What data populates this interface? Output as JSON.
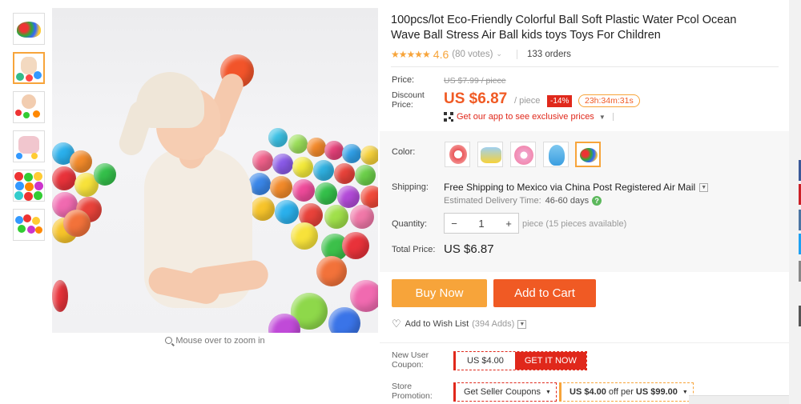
{
  "product": {
    "title": "100pcs/lot Eco-Friendly Colorful Ball Soft Plastic Water Pcol Ocean Wave Ball Stress Air Ball kids toys Toys For Children",
    "rating": "4.6",
    "stars": "★★★★★",
    "votes": "(80 votes)",
    "orders": "133 orders"
  },
  "gallery": {
    "zoom_hint": "Mouse over to zoom in"
  },
  "price": {
    "price_label": "Price:",
    "original": "US $7.99 / piece",
    "discount_label": "Discount Price:",
    "discount_value": "US $6.87",
    "unit": "/ piece",
    "percent_off": "-14%",
    "countdown": "23h:34m:31s",
    "app_promo": "Get our app to see exclusive prices"
  },
  "options": {
    "color_label": "Color:",
    "shipping_label": "Shipping:",
    "shipping_value": "Free Shipping to Mexico via China Post Registered Air Mail",
    "delivery_label": "Estimated Delivery Time:",
    "delivery_value": "46-60 days",
    "quantity_label": "Quantity:",
    "quantity_value": "1",
    "qty_minus": "−",
    "qty_plus": "+",
    "qty_available": "piece (15 pieces available)",
    "total_label": "Total Price:",
    "total_value": "US $6.87"
  },
  "actions": {
    "buy_now": "Buy Now",
    "add_to_cart": "Add to Cart",
    "wishlist": "Add to Wish List",
    "wishlist_count": "(394 Adds)"
  },
  "coupons": {
    "new_user_label": "New User Coupon:",
    "new_user_amount": "US $4.00",
    "get_it_now": "GET IT NOW",
    "store_promo_label": "Store Promotion:",
    "seller_coupons": "Get Seller Coupons",
    "promo_amount": "US $4.00",
    "promo_text": "off per",
    "promo_threshold": "US $99.00"
  },
  "colors": {
    "accent": "#f05a24",
    "orange": "#f7a43a",
    "badge_red": "#e0281b"
  }
}
